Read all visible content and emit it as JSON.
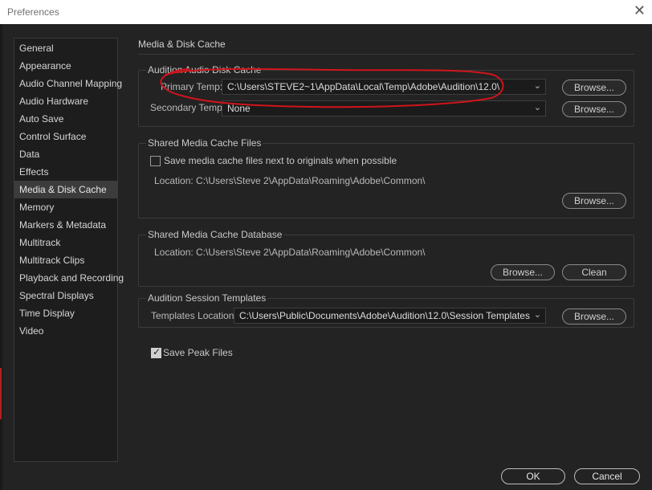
{
  "window": {
    "title": "Preferences",
    "close_glyph": "✕"
  },
  "sidebar": {
    "items": [
      {
        "label": "General"
      },
      {
        "label": "Appearance"
      },
      {
        "label": "Audio Channel Mapping"
      },
      {
        "label": "Audio Hardware"
      },
      {
        "label": "Auto Save"
      },
      {
        "label": "Control Surface"
      },
      {
        "label": "Data"
      },
      {
        "label": "Effects"
      },
      {
        "label": "Media & Disk Cache",
        "selected": true
      },
      {
        "label": "Memory"
      },
      {
        "label": "Markers & Metadata"
      },
      {
        "label": "Multitrack"
      },
      {
        "label": "Multitrack Clips"
      },
      {
        "label": "Playback and Recording"
      },
      {
        "label": "Spectral Displays"
      },
      {
        "label": "Time Display"
      },
      {
        "label": "Video"
      }
    ]
  },
  "panel": {
    "title": "Media & Disk Cache",
    "disk_cache": {
      "group_label": "Audition Audio Disk Cache",
      "primary_label": "Primary Temp:",
      "primary_value": "C:\\Users\\STEVE2~1\\AppData\\Local\\Temp\\Adobe\\Audition\\12.0\\",
      "secondary_label": "Secondary Temp:",
      "secondary_value": "None",
      "browse_label": "Browse..."
    },
    "media_cache_files": {
      "group_label": "Shared Media Cache Files",
      "checkbox_label": "Save media cache files next to originals when possible",
      "checkbox_checked": false,
      "location_text": "Location: C:\\Users\\Steve 2\\AppData\\Roaming\\Adobe\\Common\\",
      "browse_label": "Browse..."
    },
    "media_cache_db": {
      "group_label": "Shared Media Cache Database",
      "location_text": "Location: C:\\Users\\Steve 2\\AppData\\Roaming\\Adobe\\Common\\",
      "browse_label": "Browse...",
      "clean_label": "Clean"
    },
    "session_templates": {
      "group_label": "Audition Session Templates",
      "location_label": "Templates Location:",
      "location_value": "C:\\Users\\Public\\Documents\\Adobe\\Audition\\12.0\\Session Templates",
      "browse_label": "Browse..."
    },
    "save_peak": {
      "label": "Save Peak Files",
      "checked": true
    }
  },
  "footer": {
    "ok_label": "OK",
    "cancel_label": "Cancel"
  },
  "colors": {
    "annotation_red": "#d0141c",
    "background": "#232323",
    "titlebar": "#ffffff"
  },
  "icons": {
    "dropdown": "chevron-down-icon",
    "close": "close-icon",
    "check": "check-icon"
  }
}
